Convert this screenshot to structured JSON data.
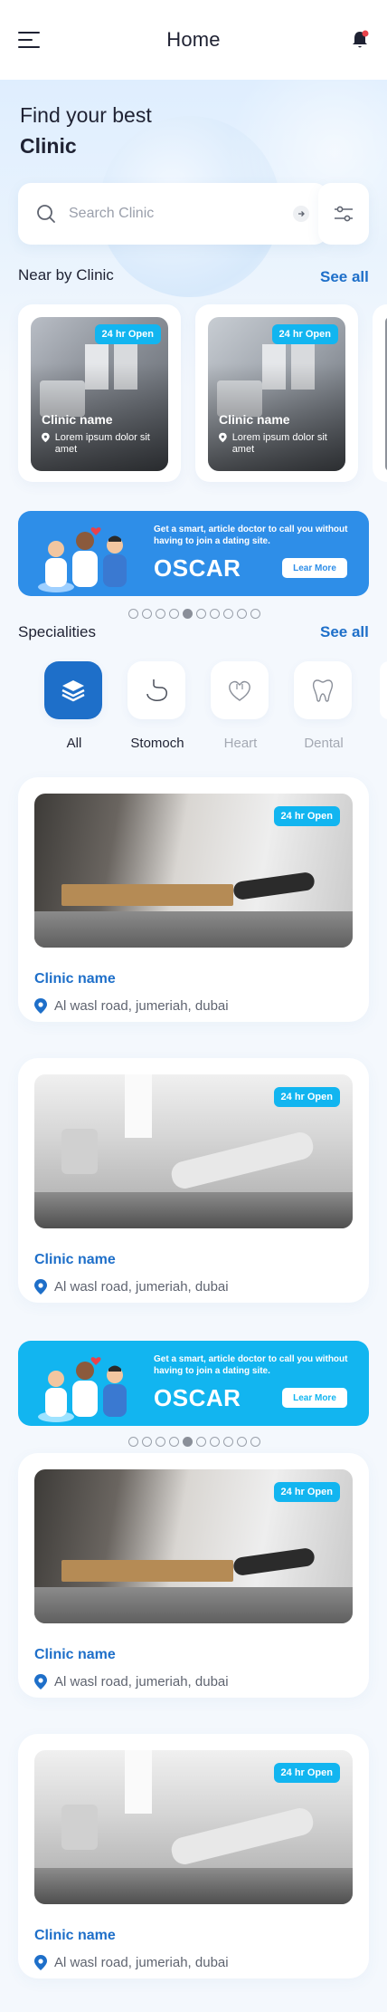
{
  "header": {
    "title": "Home"
  },
  "hero": {
    "line1": "Find your best",
    "line2": "Clinic"
  },
  "search": {
    "placeholder": "Search Clinic"
  },
  "nearby": {
    "title": "Near by Clinic",
    "see_all": "See all",
    "cards": [
      {
        "badge": "24 hr Open",
        "name": "Clinic name",
        "address": "Lorem ipsum dolor sit amet"
      },
      {
        "badge": "24 hr Open",
        "name": "Clinic name",
        "address": "Lorem ipsum dolor sit amet"
      }
    ]
  },
  "banners": [
    {
      "tagline": "Get a smart, article doctor to call you without having to join a dating site.",
      "brand": "OSCAR",
      "button": "Lear More",
      "color": "#2e8ee8"
    },
    {
      "tagline": "Get a smart, article doctor to call you without having to join a dating site.",
      "brand": "OSCAR",
      "button": "Lear More",
      "color": "#12b5f0"
    }
  ],
  "carousel": {
    "total": 10,
    "active_index": 4
  },
  "specialities": {
    "title": "Specialities",
    "see_all": "See all",
    "items": [
      {
        "label": "All",
        "icon": "layers-icon",
        "active": true
      },
      {
        "label": "Stomoch",
        "icon": "stomach-icon",
        "active": false
      },
      {
        "label": "Heart",
        "icon": "heart-icon",
        "active": false
      },
      {
        "label": "Dental",
        "icon": "tooth-icon",
        "active": false
      }
    ]
  },
  "clinics": [
    {
      "badge": "24 hr Open",
      "name": "Clinic name",
      "address": "Al wasl road, jumeriah, dubai"
    },
    {
      "badge": "24 hr Open",
      "name": "Clinic name",
      "address": "Al wasl road, jumeriah, dubai"
    },
    {
      "badge": "24 hr Open",
      "name": "Clinic name",
      "address": "Al wasl road, jumeriah, dubai"
    },
    {
      "badge": "24 hr Open",
      "name": "Clinic name",
      "address": "Al wasl road, jumeriah, dubai"
    }
  ],
  "colors": {
    "primary": "#1e6fc9",
    "badge": "#12b5f0",
    "notification": "#e8424b"
  }
}
